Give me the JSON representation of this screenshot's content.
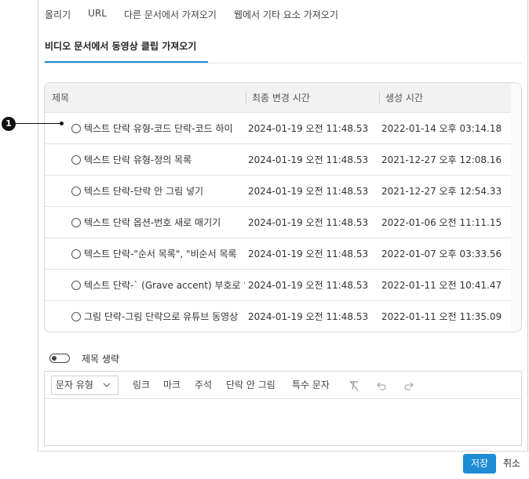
{
  "tabs": [
    "올리기",
    "URL",
    "다른 문서에서 가져오기",
    "웹에서 기타 요소 가져오기"
  ],
  "active_tab": "비디오 문서에서 동영상 클립 가져오기",
  "grid": {
    "columns": [
      "제목",
      "최종 변경 시간",
      "생성 시간"
    ],
    "rows": [
      {
        "title": "텍스트 단락 유형-코드 단락-코드 하이",
        "modified": "2024-01-19 오전 11:48.53",
        "created": "2022-01-14 오후 03:14.18"
      },
      {
        "title": "텍스트 단락 유형-정의 목록",
        "modified": "2024-01-19 오전 11:48.53",
        "created": "2021-12-27 오후 12:08.16"
      },
      {
        "title": "텍스트 단락-단락 안 그림 넣기",
        "modified": "2024-01-19 오전 11:48.53",
        "created": "2021-12-27 오후 12:54.33"
      },
      {
        "title": "텍스트 단락 옵션-번호 새로 매기기",
        "modified": "2024-01-19 오전 11:48.53",
        "created": "2022-01-06 오전 11:11.15"
      },
      {
        "title": "텍스트 단락-\"순서 목록\", \"비순서 목록",
        "modified": "2024-01-19 오전 11:48.53",
        "created": "2022-01-07 오후 03:33.56"
      },
      {
        "title": "텍스트 단락-` (Grave accent) 부호로 '",
        "modified": "2024-01-19 오전 11:48.53",
        "created": "2022-01-11 오전 10:41.47"
      },
      {
        "title": "그림 단락-그림 단락으로 유튜브 동영상",
        "modified": "2024-01-19 오전 11:48.53",
        "created": "2022-01-11 오전 11:35.09"
      }
    ]
  },
  "callout": "1",
  "toggle": {
    "label": "제목 생략",
    "on": false
  },
  "editor": {
    "style_select": "문자 유형",
    "tools": [
      "링크",
      "마크",
      "주석",
      "단락 안 그림",
      "특수 문자"
    ],
    "icons": [
      "clear-format-icon",
      "undo-icon",
      "redo-icon"
    ]
  },
  "footer": {
    "save": "저장",
    "cancel": "취소"
  },
  "colors": {
    "accent": "#1e8cd6"
  }
}
